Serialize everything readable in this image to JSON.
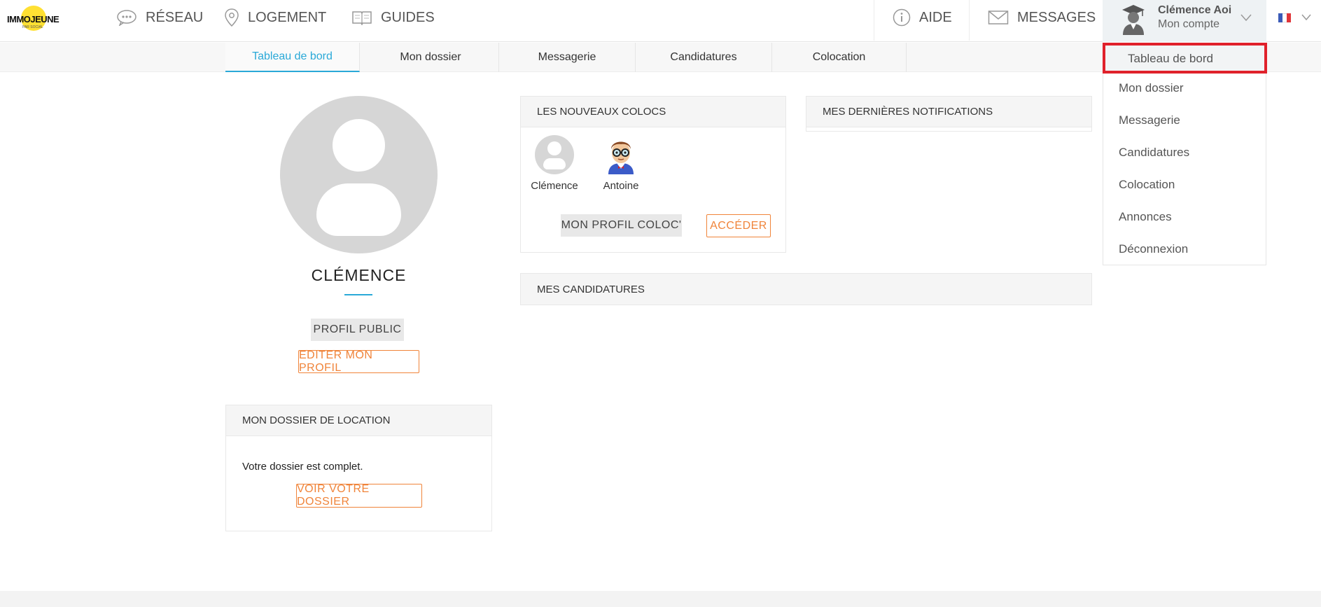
{
  "header": {
    "logo_text": "IMMOJEUNE",
    "logo_tagline": "PAR SOCIAL",
    "nav": [
      {
        "label": "RÉSEAU",
        "icon": "chat-bubble-icon"
      },
      {
        "label": "LOGEMENT",
        "icon": "map-pin-icon"
      },
      {
        "label": "GUIDES",
        "icon": "book-icon"
      }
    ],
    "aide_label": "AIDE",
    "messages_label": "MESSAGES",
    "account": {
      "name": "Clémence Aoi",
      "subtitle": "Mon compte"
    },
    "flag_colors": [
      "#3b5bb8",
      "#ffffff",
      "#e0353a"
    ]
  },
  "tabs": [
    {
      "label": "Tableau de bord",
      "active": true
    },
    {
      "label": "Mon dossier",
      "active": false
    },
    {
      "label": "Messagerie",
      "active": false
    },
    {
      "label": "Candidatures",
      "active": false
    },
    {
      "label": "Colocation",
      "active": false
    }
  ],
  "dropdown": {
    "highlighted": "Tableau de bord",
    "items": [
      "Mon dossier",
      "Messagerie",
      "Candidatures",
      "Colocation",
      "Annonces",
      "Déconnexion"
    ]
  },
  "profile": {
    "name": "CLÉMENCE",
    "public_button": "PROFIL PUBLIC",
    "edit_button": "EDITER MON PROFIL"
  },
  "dossier_panel": {
    "title": "MON DOSSIER DE LOCATION",
    "status": "Votre dossier est complet.",
    "button": "VOIR VOTRE DOSSIER"
  },
  "colocs_panel": {
    "title": "LES NOUVEAUX COLOCS",
    "members": [
      "Clémence",
      "Antoine"
    ],
    "profile_button": "MON PROFIL COLOC'",
    "access_button": "ACCÉDER"
  },
  "notifications_panel": {
    "title": "MES DERNIÈRES NOTIFICATIONS"
  },
  "candidatures_panel": {
    "title": "MES CANDIDATURES"
  },
  "colors": {
    "accent_blue": "#2aa9d8",
    "accent_orange": "#f0843a",
    "highlight_red": "#e0212b",
    "logo_yellow": "#ffe033"
  }
}
